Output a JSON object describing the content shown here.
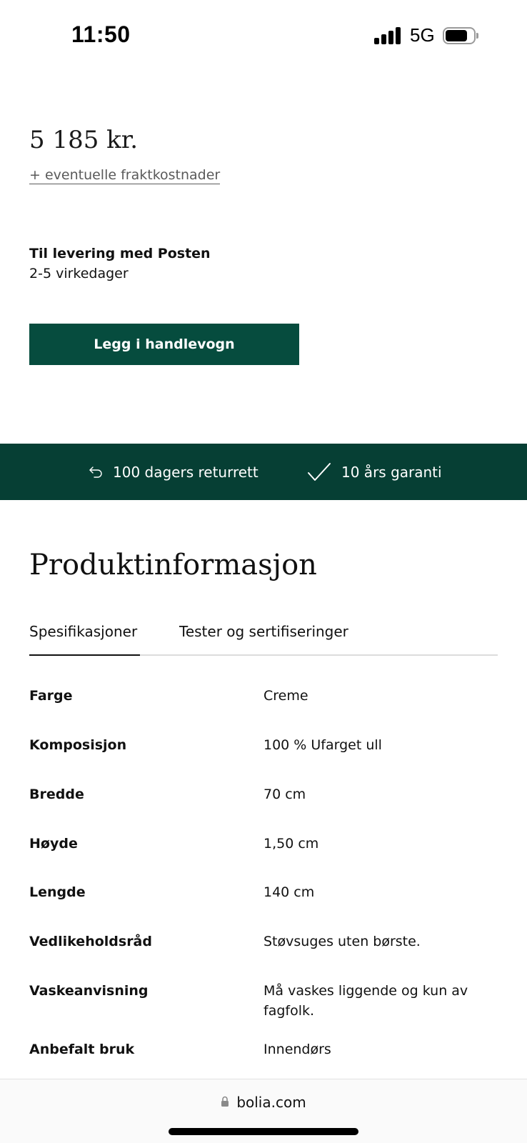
{
  "status_bar": {
    "time": "11:50",
    "network": "5G",
    "icons": [
      "signal-icon",
      "battery-icon"
    ]
  },
  "product": {
    "price": "5 185 kr.",
    "shipping_note": "+ eventuelle fraktkostnader",
    "delivery_title": "Til levering med Posten",
    "delivery_time": "2-5 virkedager",
    "add_to_cart_label": "Legg i handlevogn"
  },
  "benefits": {
    "return_label": "100 dagers returrett",
    "return_icon": "return-arrow-icon",
    "warranty_label": "10 års garanti",
    "warranty_icon": "checkmark-icon",
    "band_color": "#063f34"
  },
  "product_info": {
    "heading": "Produktinformasjon",
    "tabs": [
      {
        "label": "Spesifikasjoner",
        "active": true
      },
      {
        "label": "Tester og sertifiseringer",
        "active": false
      }
    ],
    "specs": [
      {
        "label": "Farge",
        "value": "Creme"
      },
      {
        "label": "Komposisjon",
        "value": "100 % Ufarget ull"
      },
      {
        "label": "Bredde",
        "value": "70 cm"
      },
      {
        "label": "Høyde",
        "value": "1,50 cm"
      },
      {
        "label": "Lengde",
        "value": "140 cm"
      },
      {
        "label": "Vedlikeholdsråd",
        "value": "Støvsuges uten børste."
      },
      {
        "label": "Vaskeanvisning",
        "value": "Må vaskes liggende og kun av fagfolk."
      },
      {
        "label": "Anbefalt bruk",
        "value": "Innendørs"
      }
    ]
  },
  "browser": {
    "url": "bolia.com",
    "icon": "lock-icon"
  },
  "colors": {
    "brand_green": "#064c3e",
    "band_green": "#063f34"
  }
}
